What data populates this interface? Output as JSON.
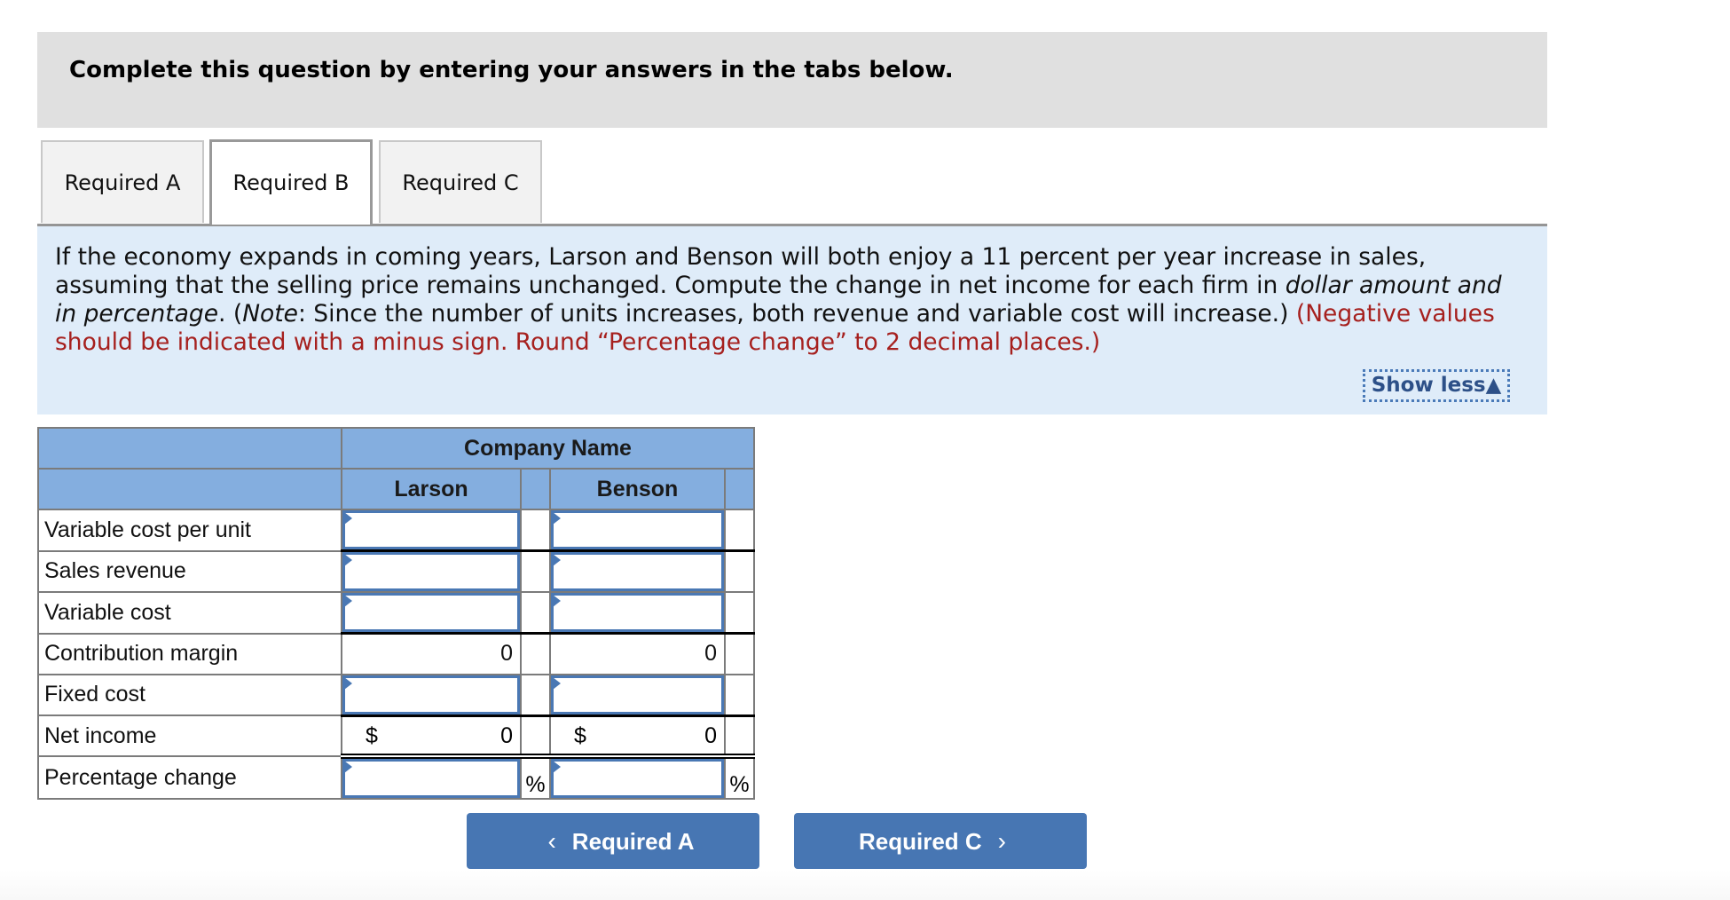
{
  "instructions": "Complete this question by entering your answers in the tabs below.",
  "tabs": [
    {
      "label": "Required A",
      "active": false
    },
    {
      "label": "Required B",
      "active": true
    },
    {
      "label": "Required C",
      "active": false
    }
  ],
  "question": {
    "part1": "If the economy expands in coming years, Larson and Benson will both enjoy a 11 percent per year increase in sales, assuming that the selling price remains unchanged. Compute the change in net income for each firm in ",
    "part1_italic": "dollar amount and in percentage",
    "part2": ". (",
    "note_italic": "Note",
    "part3": ": Since the number of units increases, both revenue and variable cost will increase.) ",
    "red_text": "(Negative values should be indicated with a minus sign. Round “Percentage change” to 2 decimal places.)",
    "show_less_label": "Show less",
    "show_less_icon": "▲"
  },
  "table": {
    "group_header": "Company Name",
    "columns": [
      "Larson",
      "Benson"
    ],
    "rows": [
      {
        "label": "Variable cost per unit",
        "larson": "",
        "benson": ""
      },
      {
        "label": "Sales revenue",
        "larson": "",
        "benson": ""
      },
      {
        "label": "Variable cost",
        "larson": "",
        "benson": ""
      },
      {
        "label": "Contribution margin",
        "larson": "0",
        "benson": "0"
      },
      {
        "label": "Fixed cost",
        "larson": "",
        "benson": ""
      },
      {
        "label": "Net income",
        "currency": "$",
        "larson": "0",
        "benson": "0"
      },
      {
        "label": "Percentage change",
        "larson": "",
        "benson": "",
        "unit": "%"
      }
    ]
  },
  "nav": {
    "prev_label": "Required A",
    "prev_icon": "‹",
    "next_label": "Required C",
    "next_icon": "›"
  }
}
